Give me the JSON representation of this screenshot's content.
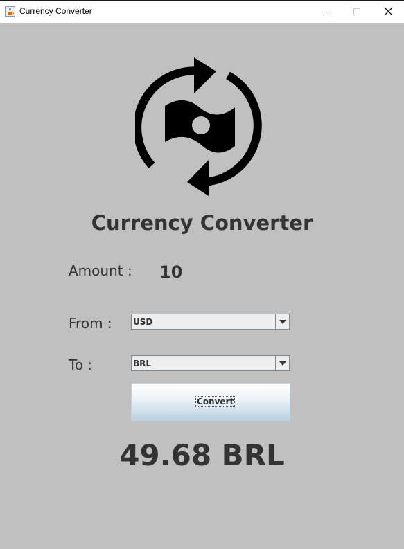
{
  "window": {
    "title": "Currency Converter",
    "minimize_icon": "minimize-icon",
    "maximize_icon": "maximize-icon",
    "close_icon": "close-icon",
    "app_icon": "java-coffee-cup-icon"
  },
  "main": {
    "logo_icon": "currency-exchange-icon",
    "heading": "Currency Converter",
    "amount_label": "Amount :",
    "amount_value": "10",
    "from_label": "From :",
    "from_selected": "USD",
    "to_label": "To :",
    "to_selected": "BRL",
    "convert_label": "Convert",
    "result": "49.68 BRL"
  },
  "colors": {
    "background": "#c0c0c0",
    "text": "#333333",
    "titlebar": "#ffffff"
  }
}
